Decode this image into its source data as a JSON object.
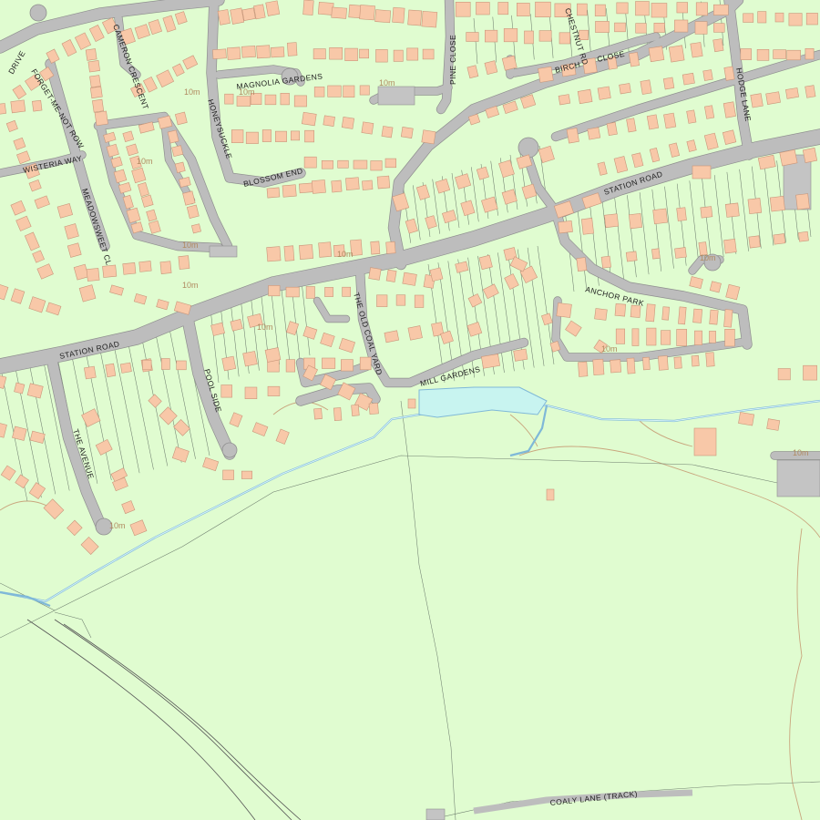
{
  "map": {
    "colors": {
      "land": "#e0fcd0",
      "building": "#f8c8a8",
      "road": "#bdbdbd",
      "water": "#7fb8d8",
      "lake": "#c8f4f0",
      "contour": "#c9a67e"
    },
    "street_labels": {
      "station_road_west": "STATION ROAD",
      "station_road_east": "STATION ROAD",
      "magnolia_gardens": "MAGNOLIA GARDENS",
      "blossom_end": "BLOSSOM END",
      "honeysuckle": "HONEYSUCKLE",
      "pine_close": "PINE CLOSE",
      "chestnut_rd": "CHESTNUT RD",
      "birch": "BIRCH",
      "close": "CLOSE",
      "hodge_lane": "HODGE LANE",
      "cameron_crescent": "CAMERON CRESCENT",
      "drive": "DRIVE",
      "forget_me_not_row": "FORGET-ME-NOT ROW",
      "wisteria_way": "WISTERIA WAY",
      "meadowsweet_cl": "MEADOWSWEET CL",
      "the_old_coal_yard": "THE OLD COAL YARD",
      "anchor_park": "ANCHOR PARK",
      "mill_gardens": "MILL GARDENS",
      "pool_side": "POOL SIDE",
      "the_avenue": "THE AVENUE",
      "coaly_lane": "COALY LANE (TRACK)"
    },
    "contour_label": "10m"
  }
}
